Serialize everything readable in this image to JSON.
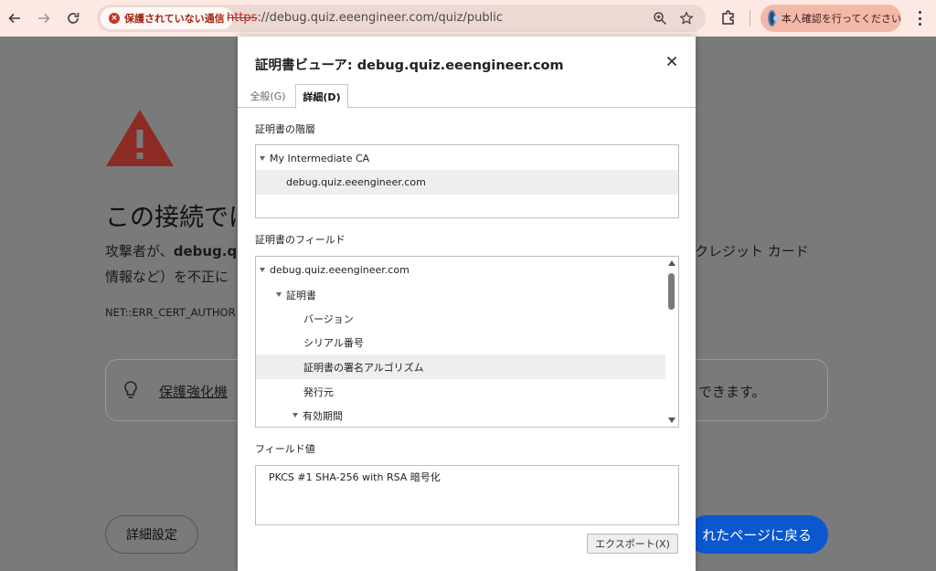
{
  "browser": {
    "security_chip": "保護されていない通信",
    "url_scheme": "https",
    "url_rest": "://debug.quiz.eeengineer.com/quiz/public",
    "profile_label": "本人確認を行ってください"
  },
  "page": {
    "title": "この接続では",
    "desc_line1_prefix": "攻撃者が、",
    "desc_line1_bold": "debug.q",
    "desc_line1_right": "クレジット カード",
    "desc_line2": "情報など）を不正に",
    "error_code": "NET::ERR_CERT_AUTHOR",
    "protect_link": "保護強化機",
    "protect_rest": "できます。",
    "advanced_button": "詳細設定",
    "back_button": "れたページに戻る"
  },
  "dialog": {
    "title": "証明書ビューア: debug.quiz.eeengineer.com",
    "tabs": [
      {
        "label": "全般(G)"
      },
      {
        "label": "詳細(D)"
      }
    ],
    "hierarchy_label": "証明書の階層",
    "hierarchy": [
      {
        "label": "My Intermediate CA"
      },
      {
        "label": "debug.quiz.eeengineer.com"
      }
    ],
    "fields_label": "証明書のフィールド",
    "fields": [
      {
        "label": "debug.quiz.eeengineer.com"
      },
      {
        "label": "証明書"
      },
      {
        "label": "バージョン"
      },
      {
        "label": "シリアル番号"
      },
      {
        "label": "証明書の署名アルゴリズム"
      },
      {
        "label": "発行元"
      },
      {
        "label": "有効期間"
      }
    ],
    "field_value_label": "フィールド値",
    "field_value": "PKCS #1 SHA-256 with RSA 暗号化",
    "export_button": "エクスポート(X)"
  }
}
